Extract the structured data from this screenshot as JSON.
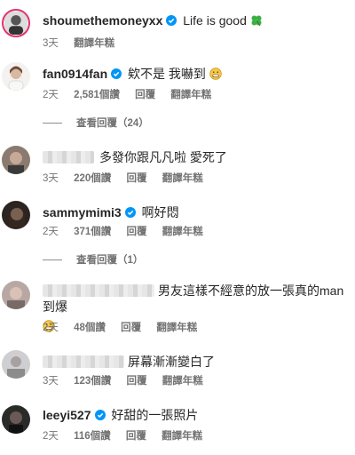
{
  "comments": [
    {
      "username": "shoumethemoneyxx",
      "verified": true,
      "text": "Life is good",
      "emoji": "four-leaf-clover",
      "time": "3天",
      "likes": "",
      "reply": "",
      "translate": "翻譯年糕"
    },
    {
      "username": "fan0914fan",
      "verified": true,
      "text": "欸不是 我嚇到",
      "emoji": "grimacing-face",
      "time": "2天",
      "likes": "2,581個讚",
      "reply": "回覆",
      "translate": "翻譯年糕",
      "view_replies": "查看回覆（24）"
    },
    {
      "username": "",
      "verified": false,
      "text": "多發你跟凡凡啦 愛死了",
      "time": "3天",
      "likes": "220個讚",
      "reply": "回覆",
      "translate": "翻譯年糕"
    },
    {
      "username": "sammymimi3",
      "verified": true,
      "text": "啊好悶",
      "time": "2天",
      "likes": "371個讚",
      "reply": "回覆",
      "translate": "翻譯年糕",
      "view_replies": "查看回覆（1）"
    },
    {
      "username": "",
      "verified": false,
      "text": "男友這樣不經意的放一張真的man到爆",
      "emoji": "grimacing-face",
      "time": "2天",
      "likes": "48個讚",
      "reply": "回覆",
      "translate": "翻譯年糕"
    },
    {
      "username": "",
      "verified": false,
      "text": "屏幕漸漸變白了",
      "time": "3天",
      "likes": "123個讚",
      "reply": "回覆",
      "translate": "翻譯年糕"
    },
    {
      "username": "leeyi527",
      "verified": true,
      "text": "好甜的一張照片",
      "time": "2天",
      "likes": "116個讚",
      "reply": "回覆",
      "translate": "翻譯年糕"
    }
  ],
  "colors": {
    "verified": "#0095f6",
    "text": "#262626",
    "meta": "#737373"
  }
}
